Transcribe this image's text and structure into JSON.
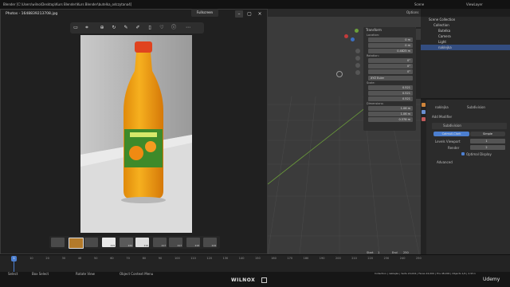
{
  "blender": {
    "title_path": "Blender [C:\\Users\\wilno\\Desktop\\Kurs Blender\\Kurs Blender\\butelka_odczytana4]",
    "top_menu": [
      "Scene",
      "ViewLayer"
    ],
    "viewport": {
      "options_label": "Options"
    },
    "n_panel": {
      "transform_label": "Transform",
      "location_label": "Location:",
      "loc": [
        {
          "axis": "X",
          "value": "0 m"
        },
        {
          "axis": "Y",
          "value": "0 m"
        },
        {
          "axis": "Z",
          "value": "0.4825 m"
        }
      ],
      "rotation_label": "Rotation:",
      "rot": [
        {
          "axis": "X",
          "value": "0°"
        },
        {
          "axis": "Y",
          "value": "0°"
        },
        {
          "axis": "Z",
          "value": "0°"
        }
      ],
      "mode": "XYZ Euler",
      "scale_label": "Scale:",
      "scale": [
        {
          "axis": "X",
          "value": "0.521"
        },
        {
          "axis": "Y",
          "value": "0.521"
        },
        {
          "axis": "Z",
          "value": "0.521"
        }
      ],
      "dimensions_label": "Dimensions:",
      "dims": [
        {
          "axis": "X",
          "value": "1.06 m"
        },
        {
          "axis": "Y",
          "value": "1.06 m"
        },
        {
          "axis": "Z",
          "value": "0.378 m"
        }
      ]
    },
    "side_tabs": [
      "Item",
      "Tool",
      "View",
      "Screenshot Keys"
    ],
    "outliner": {
      "scene_collection": "Scene Collection",
      "items": [
        "Collection",
        "Butelka",
        "Camera",
        "Light",
        "naklejka"
      ]
    },
    "properties": {
      "object_name": "naklejka",
      "modifier_tag": "Subdivision",
      "add_modifier": "Add Modifier",
      "mod_name": "Subdivision",
      "tab_catmull": "Catmull-Clark",
      "tab_simple": "Simple",
      "levels_viewport_label": "Levels Viewport",
      "levels_viewport": "1",
      "render_label": "Render",
      "render_value": "2",
      "optimal_display": "Optimal Display",
      "advanced": "Advanced"
    },
    "timeline": {
      "frame_numbers": [
        "0",
        "10",
        "20",
        "30",
        "40",
        "50",
        "60",
        "70",
        "80",
        "90",
        "100",
        "110",
        "120",
        "130",
        "140",
        "150",
        "160",
        "170",
        "180",
        "190",
        "200",
        "210",
        "220",
        "230",
        "240",
        "250"
      ],
      "current_frame": "1",
      "start_label": "Start",
      "start_value": "1",
      "end_label": "End",
      "end_value": "250"
    },
    "status": {
      "select": "Select",
      "box_select": "Box Select",
      "rotate_view": "Rotate View",
      "context_menu": "Object Context Menu",
      "right_info": "Collection | naklejka | Verts 24,004 | Faces 24,000 | Tris 48,000 | Objects 1/4 | 2.93.1"
    },
    "watermark_left": "WILNOX",
    "watermark_right": "Udemy"
  },
  "photos": {
    "title": "Photos - 1648839213708.jpg",
    "fullscreen_label": "Fullscreen",
    "toolbar_icons": [
      "info-icon",
      "crop-icon",
      "zoom-in-icon",
      "rotate-icon",
      "edit-icon",
      "draw-icon",
      "delete-icon",
      "heart-icon",
      "info-circle-icon",
      "more-icon"
    ],
    "thumbnail_labels": [
      "",
      "",
      "",
      "219",
      "220",
      "216",
      "217",
      "217",
      "218",
      "219",
      "220"
    ],
    "window_buttons": [
      "minimize-icon",
      "restore-icon",
      "close-icon"
    ],
    "colors": {
      "bg": "#202020",
      "toolbar": "#2e2e2e",
      "accent": "#4c7fd0"
    }
  }
}
